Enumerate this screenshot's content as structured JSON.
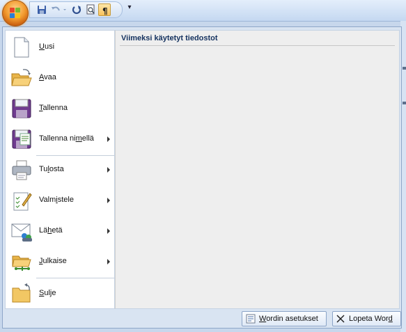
{
  "qat": {
    "buttons": [
      "save-icon",
      "undo-icon",
      "redo-icon",
      "print-preview-icon",
      "show-formatting-icon"
    ],
    "more_label": "▾"
  },
  "recent": {
    "title": "Viimeksi käytetyt tiedostot"
  },
  "menu": {
    "items": [
      {
        "label": "Uusi",
        "accel": "U",
        "icon": "new-document-icon",
        "submenu": false
      },
      {
        "label": "Avaa",
        "accel": "A",
        "icon": "open-folder-icon",
        "submenu": false
      },
      {
        "label": "Tallenna",
        "accel": "T",
        "icon": "save-floppy-icon",
        "submenu": false
      },
      {
        "label": "Tallenna nimellä",
        "accel": "m",
        "icon": "save-as-icon",
        "submenu": true
      },
      {
        "label": "Tulosta",
        "accel": "l",
        "icon": "printer-icon",
        "submenu": true
      },
      {
        "label": "Valmistele",
        "accel": "i",
        "icon": "prepare-icon",
        "submenu": true
      },
      {
        "label": "Lähetä",
        "accel": "h",
        "icon": "send-icon",
        "submenu": true
      },
      {
        "label": "Julkaise",
        "accel": "J",
        "icon": "publish-icon",
        "submenu": true
      },
      {
        "label": "Sulje",
        "accel": "S",
        "icon": "close-folder-icon",
        "submenu": false
      }
    ]
  },
  "bottom": {
    "options_label": "Wordin asetukset",
    "exit_label": "Lopeta Word"
  },
  "colors": {
    "accent": "#15325f",
    "menu_bg": "#d9e4f2",
    "orb": "#f29a2e"
  }
}
